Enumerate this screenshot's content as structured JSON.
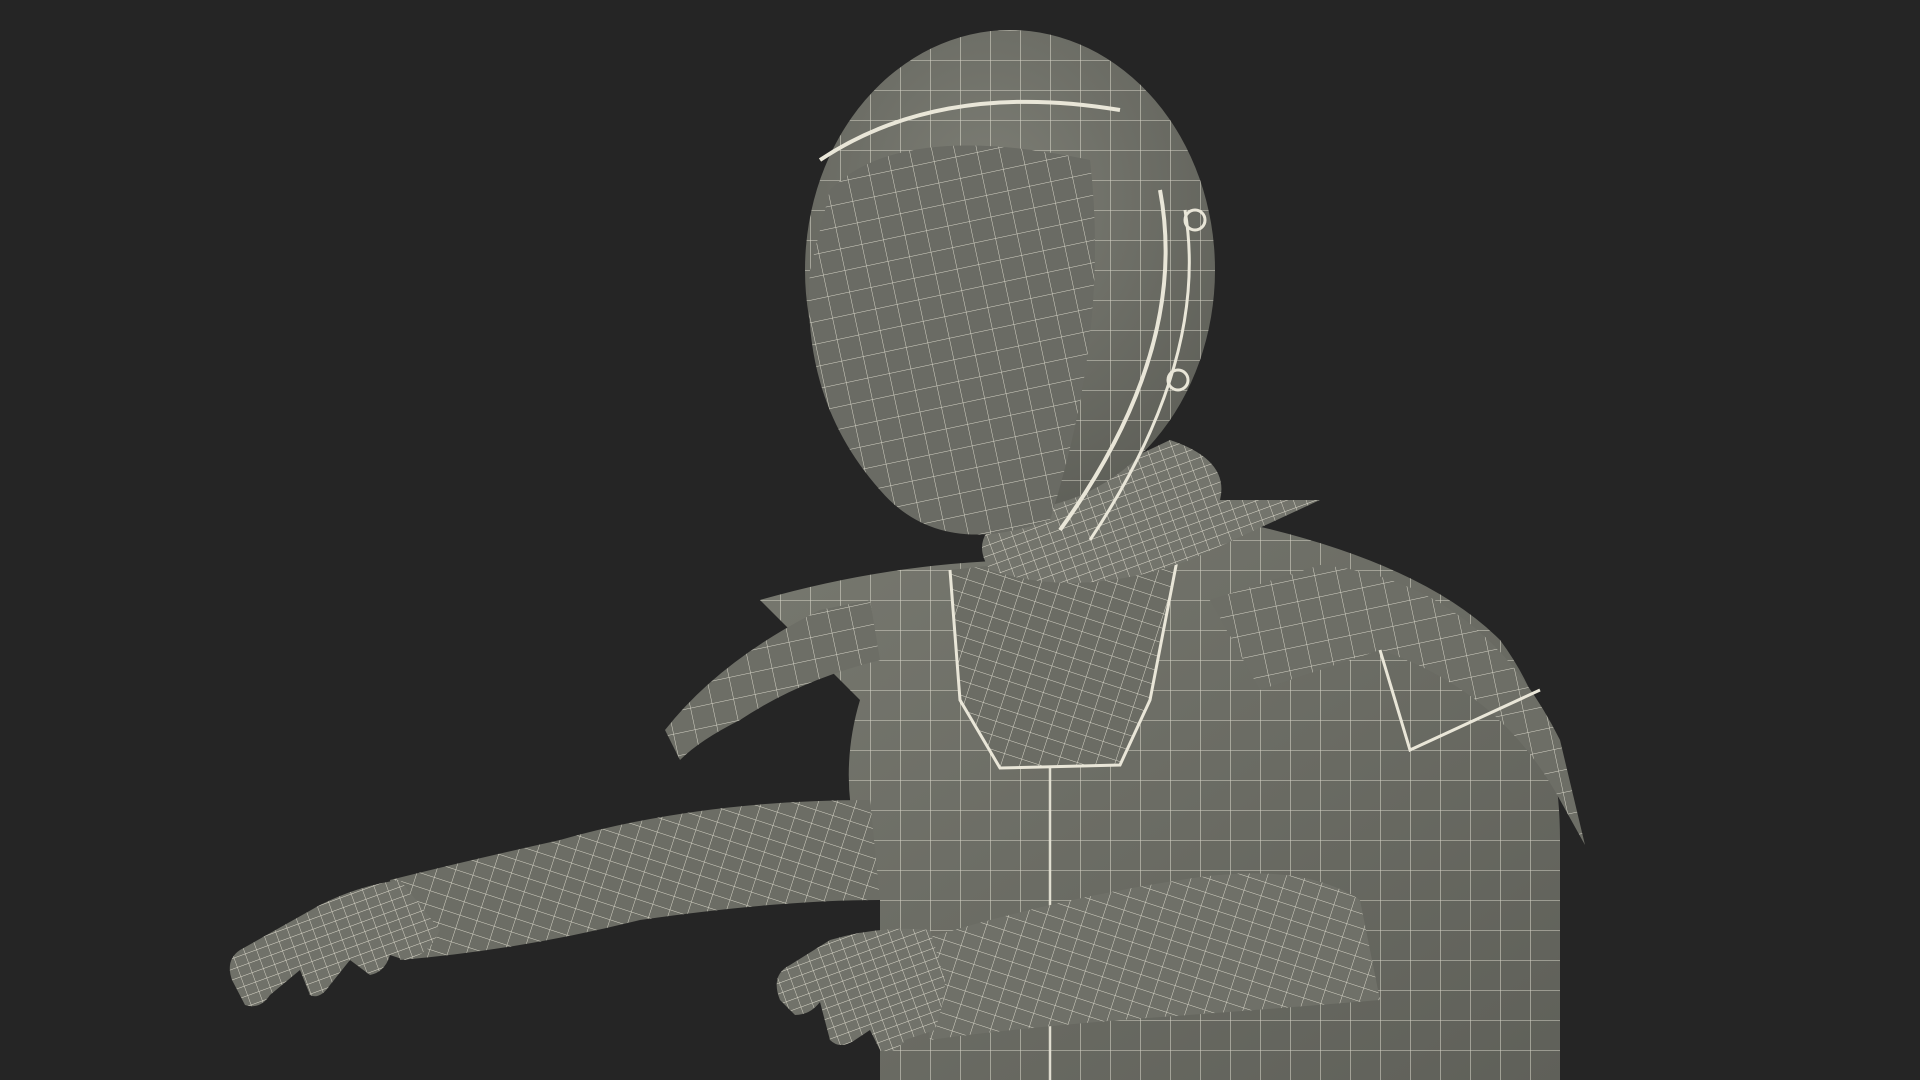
{
  "scene": {
    "subject": "wireframe-astronaut-figure",
    "colors": {
      "background": "#252525",
      "surface": "#6f7068",
      "surface_light": "#7c7d74",
      "surface_dark": "#5c5d56",
      "wire": "#e9e6d8"
    }
  }
}
